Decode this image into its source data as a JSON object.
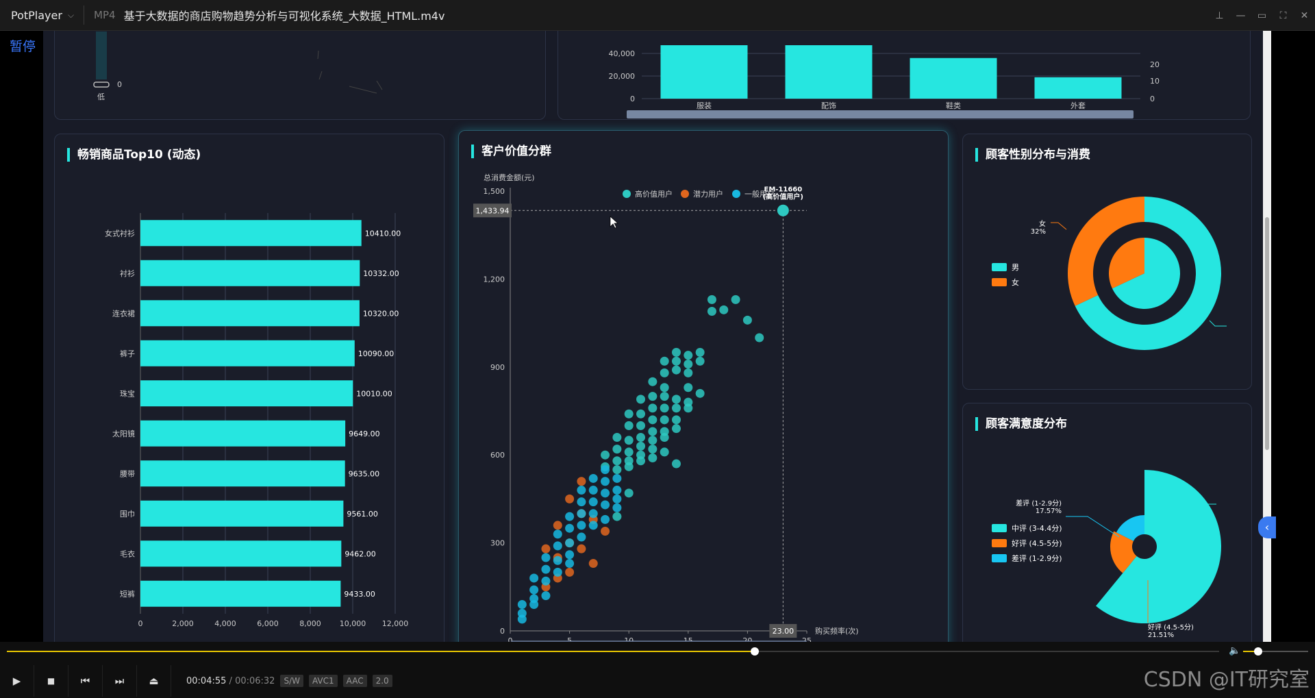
{
  "titlebar": {
    "app": "PotPlayer",
    "app_arrow": "⌵",
    "format": "MP4",
    "file": "基于大数据的商店购物趋势分析与可视化系统_大数据_HTML.m4v",
    "ctrl_pin": "⊥",
    "ctrl_min": "—",
    "ctrl_max": "▭",
    "ctrl_full": "⛶",
    "ctrl_close": "✕"
  },
  "pause_label": "暂停",
  "heatmap_legend": {
    "low": "低",
    "zero": "0"
  },
  "sales_chart": {
    "chart_data": {
      "type": "bar",
      "categories": [
        "服装",
        "配饰",
        "鞋类",
        "外套"
      ],
      "y_left_ticks": [
        "40,000",
        "20,000",
        "0"
      ],
      "y_right_ticks": [
        "20",
        "10",
        "0"
      ],
      "values_relative": [
        1.0,
        1.0,
        0.76,
        0.4
      ]
    }
  },
  "top10": {
    "title": "畅销商品Top10 (动态)",
    "chart_data": {
      "type": "bar",
      "orientation": "horizontal",
      "categories": [
        "女式衬衫",
        "衬衫",
        "连衣裙",
        "裤子",
        "珠宝",
        "太阳镜",
        "腰带",
        "围巾",
        "毛衣",
        "短裤"
      ],
      "values": [
        10410.0,
        10332.0,
        10320.0,
        10090.0,
        10010.0,
        9649.0,
        9635.0,
        9561.0,
        9462.0,
        9433.0
      ],
      "value_labels": [
        "10410.00",
        "10332.00",
        "10320.00",
        "10090.00",
        "10010.00",
        "9649.00",
        "9635.00",
        "9561.00",
        "9462.00",
        "9433.00"
      ],
      "x_ticks": [
        "0",
        "2,000",
        "4,000",
        "6,000",
        "8,000",
        "10,000",
        "12,000"
      ],
      "xlim": [
        0,
        12000
      ],
      "color": "#26e6e0"
    }
  },
  "cluster": {
    "title": "客户价值分群",
    "chart_data": {
      "type": "scatter",
      "ylabel": "总消费金额(元)",
      "xlabel": "购买频率(次)",
      "xlim": [
        0,
        25
      ],
      "ylim": [
        0,
        1500
      ],
      "x_ticks": [
        "0",
        "5",
        "10",
        "15",
        "20",
        "25"
      ],
      "y_ticks": [
        "0",
        "300",
        "600",
        "900",
        "1,200",
        "1,500"
      ],
      "legend": [
        "高价值用户",
        "潜力用户",
        "一般用户"
      ],
      "colors": [
        "#2ec9c1",
        "#e0661e",
        "#18b8e0"
      ],
      "pointer_x": "23.00",
      "pointer_y": "1,433.94",
      "tooltip": "EM-11660\n(高价值用户)",
      "series": [
        {
          "name": "高价值用户",
          "points": [
            [
              17,
              1130
            ],
            [
              17,
              1090
            ],
            [
              18,
              1095
            ],
            [
              19,
              1130
            ],
            [
              20,
              1060
            ],
            [
              21,
              1000
            ],
            [
              13,
              920
            ],
            [
              13,
              880
            ],
            [
              14,
              950
            ],
            [
              14,
              920
            ],
            [
              15,
              940
            ],
            [
              15,
              910
            ],
            [
              16,
              950
            ],
            [
              16,
              920
            ],
            [
              13,
              830
            ],
            [
              13,
              800
            ],
            [
              12,
              850
            ],
            [
              12,
              800
            ],
            [
              14,
              890
            ],
            [
              15,
              880
            ],
            [
              15,
              830
            ],
            [
              16,
              810
            ],
            [
              14,
              790
            ],
            [
              14,
              760
            ],
            [
              15,
              780
            ],
            [
              15,
              760
            ],
            [
              13,
              760
            ],
            [
              13,
              720
            ],
            [
              12,
              760
            ],
            [
              12,
              720
            ],
            [
              11,
              790
            ],
            [
              11,
              740
            ],
            [
              10,
              740
            ],
            [
              10,
              700
            ],
            [
              13,
              680
            ],
            [
              13,
              660
            ],
            [
              12,
              680
            ],
            [
              12,
              650
            ],
            [
              11,
              700
            ],
            [
              11,
              660
            ],
            [
              14,
              720
            ],
            [
              14,
              690
            ],
            [
              9,
              660
            ],
            [
              9,
              620
            ],
            [
              10,
              650
            ],
            [
              10,
              610
            ],
            [
              11,
              630
            ],
            [
              11,
              600
            ],
            [
              12,
              620
            ],
            [
              12,
              590
            ],
            [
              13,
              610
            ],
            [
              14,
              570
            ],
            [
              10,
              580
            ],
            [
              10,
              560
            ],
            [
              9,
              580
            ],
            [
              9,
              550
            ],
            [
              8,
              600
            ],
            [
              8,
              560
            ],
            [
              11,
              580
            ],
            [
              10,
              470
            ],
            [
              9,
              390
            ]
          ]
        },
        {
          "name": "潜力用户",
          "points": [
            [
              6,
              510
            ],
            [
              5,
              450
            ],
            [
              4,
              360
            ],
            [
              3,
              280
            ],
            [
              4,
              250
            ],
            [
              5,
              300
            ],
            [
              7,
              230
            ],
            [
              8,
              340
            ],
            [
              6,
              400
            ],
            [
              5,
              200
            ],
            [
              4,
              180
            ],
            [
              3,
              150
            ],
            [
              6,
              280
            ],
            [
              7,
              380
            ]
          ]
        },
        {
          "name": "一般用户",
          "points": [
            [
              1,
              90
            ],
            [
              1,
              60
            ],
            [
              2,
              180
            ],
            [
              2,
              140
            ],
            [
              2,
              110
            ],
            [
              3,
              250
            ],
            [
              3,
              210
            ],
            [
              3,
              170
            ],
            [
              4,
              330
            ],
            [
              4,
              290
            ],
            [
              4,
              240
            ],
            [
              4,
              200
            ],
            [
              5,
              390
            ],
            [
              5,
              350
            ],
            [
              5,
              300
            ],
            [
              5,
              260
            ],
            [
              5,
              230
            ],
            [
              6,
              480
            ],
            [
              6,
              440
            ],
            [
              6,
              400
            ],
            [
              6,
              360
            ],
            [
              6,
              320
            ],
            [
              7,
              520
            ],
            [
              7,
              480
            ],
            [
              7,
              440
            ],
            [
              7,
              400
            ],
            [
              7,
              360
            ],
            [
              8,
              550
            ],
            [
              8,
              510
            ],
            [
              8,
              470
            ],
            [
              8,
              430
            ],
            [
              8,
              380
            ],
            [
              9,
              520
            ],
            [
              9,
              480
            ],
            [
              9,
              450
            ],
            [
              9,
              420
            ],
            [
              2,
              90
            ],
            [
              3,
              120
            ],
            [
              1,
              40
            ]
          ]
        }
      ]
    }
  },
  "gender": {
    "title": "顾客性别分布与消费",
    "legend": [
      "男",
      "女"
    ],
    "label": "女\n32%",
    "chart_data": {
      "type": "pie",
      "series": [
        {
          "name": "outer",
          "labels": [
            "男",
            "女"
          ],
          "values": [
            68,
            32
          ]
        },
        {
          "name": "inner",
          "labels": [
            "男",
            "女"
          ],
          "values": [
            68,
            32
          ]
        }
      ],
      "colors": [
        "#26e6e0",
        "#ff7a10"
      ]
    }
  },
  "satisfaction": {
    "title": "顾客满意度分布",
    "legend": [
      "中评 (3-4.4分)",
      "好评 (4.5-5分)",
      "差评 (1-2.9分)"
    ],
    "label_bad": "差评 (1-2.9分)\n17.57%",
    "label_good": "好评 (4.5-5分)\n21.51%",
    "chart_data": {
      "type": "pie",
      "subtype": "rose",
      "labels": [
        "中评 (3-4.4分)",
        "好评 (4.5-5分)",
        "差评 (1-2.9分)"
      ],
      "values": [
        60.92,
        21.51,
        17.57
      ],
      "colors": [
        "#26e6e0",
        "#ff7a10",
        "#18c6f2"
      ]
    }
  },
  "controls": {
    "current": "00:04:55",
    "sep": "/",
    "total": "00:06:32",
    "badges": [
      "S/W",
      "AVC1",
      "AAC",
      "2.0"
    ],
    "progress": 0.617,
    "volume": 0.23,
    "play": "▶",
    "stop": "■",
    "prev": "⏮",
    "next": "⏭",
    "eject": "⏏",
    "vol_icon": "🔈"
  },
  "watermark": "CSDN @IT研究室",
  "edge_button": "‹"
}
